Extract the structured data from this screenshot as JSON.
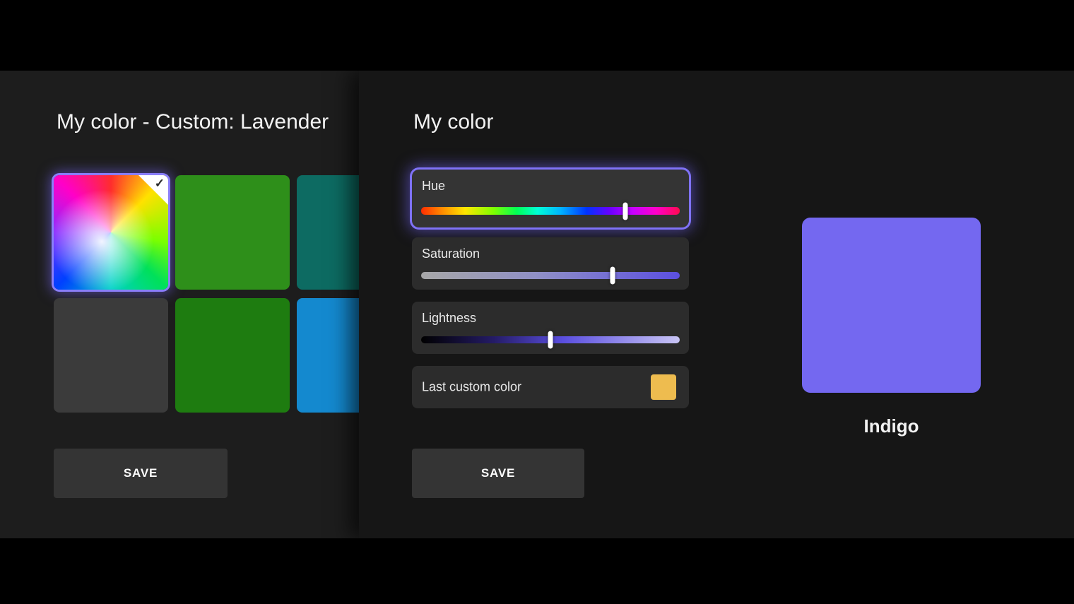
{
  "left_panel": {
    "title": "My color - Custom: Lavender",
    "save_label": "SAVE",
    "swatches": [
      {
        "name": "custom-spectrum",
        "selected": true
      },
      {
        "name": "green",
        "color": "#2e8f1a"
      },
      {
        "name": "teal",
        "color": "#0d6b62"
      },
      {
        "name": "dark-gray",
        "color": "#3b3b3b"
      },
      {
        "name": "dark-green",
        "color": "#1e7c10"
      },
      {
        "name": "blue",
        "color": "#1489cf"
      }
    ]
  },
  "right_panel": {
    "title": "My color",
    "sliders": [
      {
        "label": "Hue",
        "value_pct": 79,
        "focused": true
      },
      {
        "label": "Saturation",
        "value_pct": 74
      },
      {
        "label": "Lightness",
        "value_pct": 50
      }
    ],
    "last_custom": {
      "label": "Last custom color",
      "color": "#eebc4f"
    },
    "save_label": "SAVE",
    "preview": {
      "label": "Indigo",
      "color": "#7468f0"
    }
  },
  "icons": {
    "checkmark": "✓"
  },
  "colors": {
    "focus_ring": "#7f72f7",
    "accent_purple": "#5b4fe0",
    "panel_left_bg": "#1d1d1d",
    "panel_right_bg": "#161616"
  }
}
